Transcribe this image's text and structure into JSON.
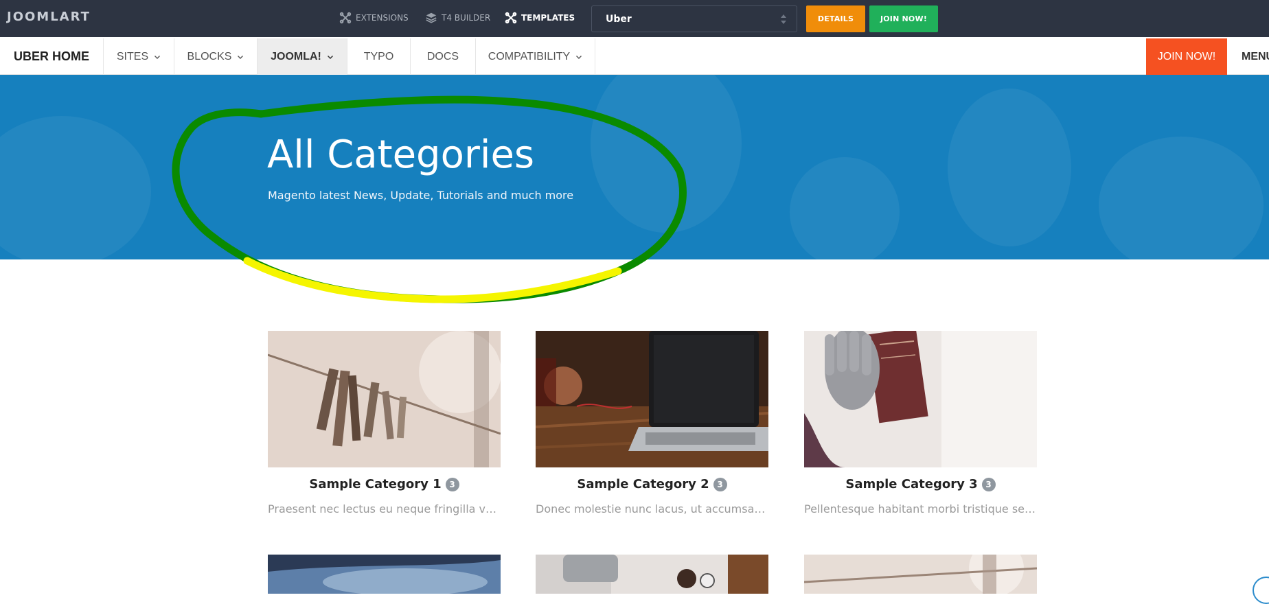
{
  "topbar": {
    "logo": "JOOMLART",
    "products": [
      {
        "label": "EXTENSIONS"
      },
      {
        "label": "T4 BUILDER"
      },
      {
        "label": "TEMPLATES"
      }
    ],
    "template_select": {
      "value": "Uber"
    },
    "details_label": "DETAILS",
    "join_label": "JOIN NOW!"
  },
  "nav": {
    "brand": "UBER HOME",
    "items": [
      {
        "label": "SITES"
      },
      {
        "label": "BLOCKS"
      },
      {
        "label": "JOOMLA!"
      },
      {
        "label": "TYPO"
      },
      {
        "label": "DOCS"
      },
      {
        "label": "COMPATIBILITY"
      }
    ],
    "join_label": "JOIN NOW!",
    "menu_label": "MENU"
  },
  "hero": {
    "title": "All Categories",
    "subtitle": "Magento latest News, Update, Tutorials and much more"
  },
  "categories": [
    {
      "title": "Sample Category 1",
      "count": "3",
      "desc": "Praesent nec lectus eu neque fringilla volutpat...."
    },
    {
      "title": "Sample Category 2",
      "count": "3",
      "desc": "Donec molestie nunc lacus, ut accumsan sem ..."
    },
    {
      "title": "Sample Category 3",
      "count": "3",
      "desc": "Pellentesque habitant morbi tristique senectus ..."
    }
  ],
  "colors": {
    "topbar_bg": "#2d3442",
    "details_btn": "#f08d0a",
    "join_btn": "#20b05a",
    "nav_join": "#f55121",
    "hero_bg": "#1680be",
    "annotation_green": "#0a8a00",
    "annotation_yellow": "#f5f500"
  }
}
